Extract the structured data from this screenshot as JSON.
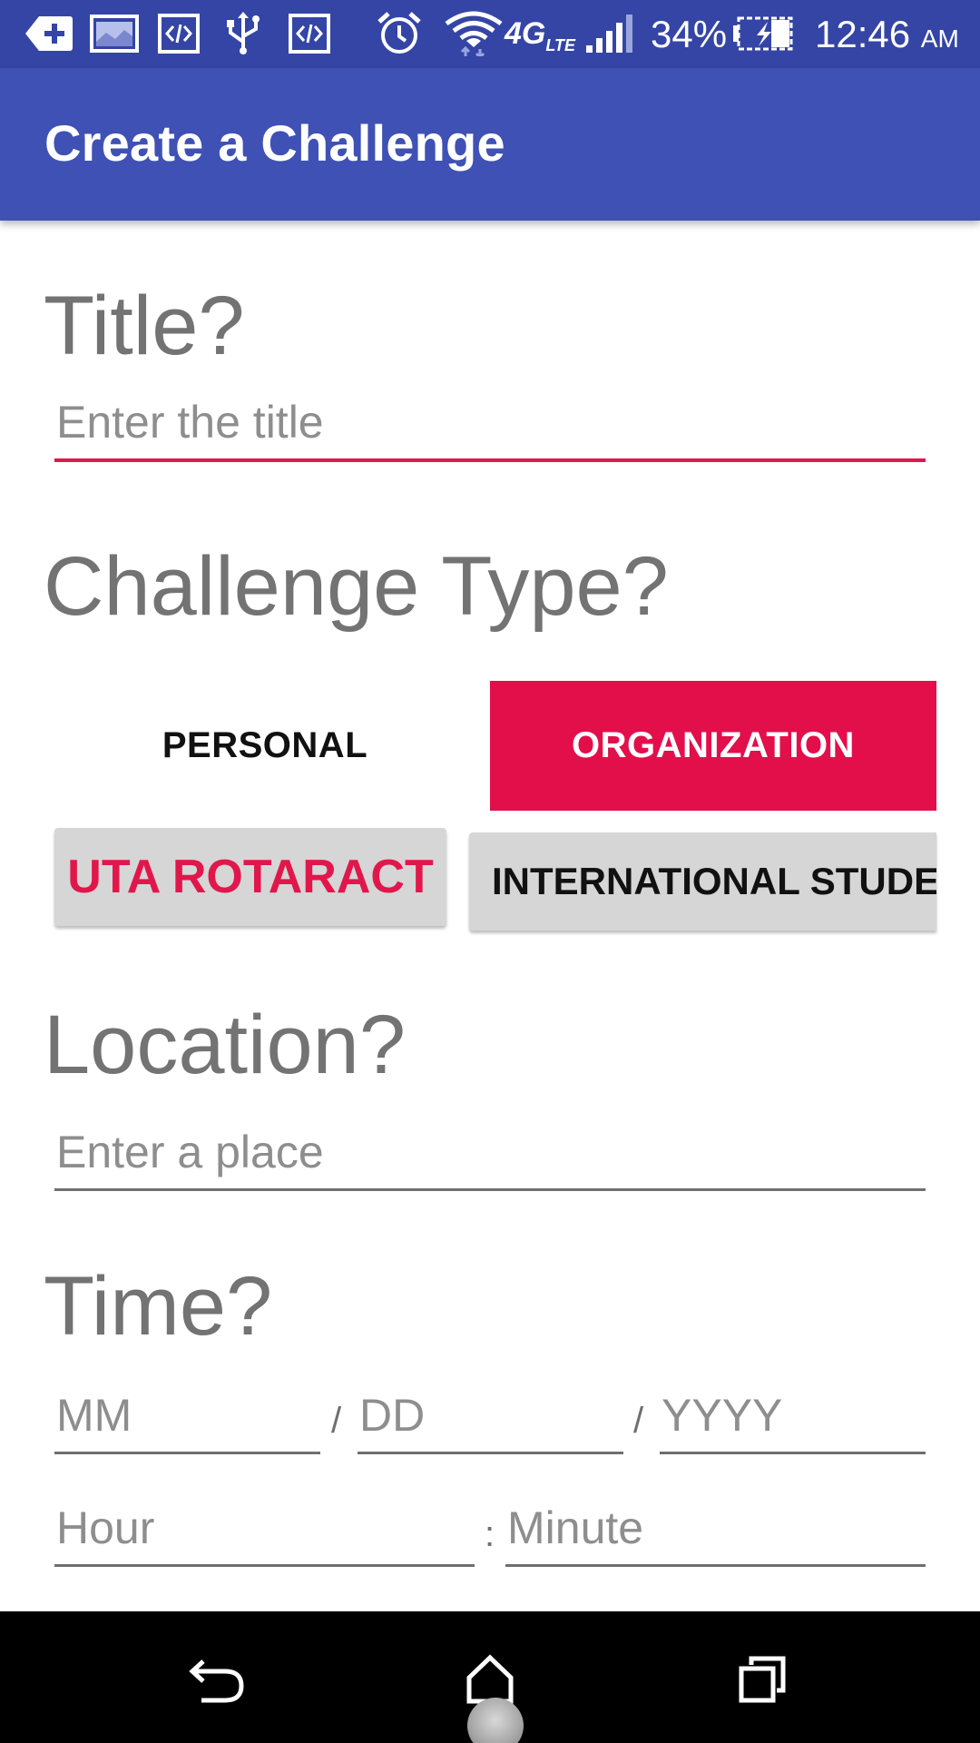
{
  "status_bar": {
    "battery_percent": "34%",
    "time": "12:46",
    "ampm": "AM",
    "network": "4G",
    "network_sub": "LTE",
    "icons": [
      "add-box-icon",
      "image-icon",
      "code-icon",
      "usb-icon",
      "code-icon",
      "alarm-icon",
      "wifi-icon",
      "signal-icon",
      "battery-charging-icon"
    ]
  },
  "app_bar": {
    "title": "Create a Challenge"
  },
  "form": {
    "title_label": "Title?",
    "title_placeholder": "Enter the title",
    "title_value": "",
    "type_label": "Challenge Type?",
    "type_options": [
      "PERSONAL",
      "ORGANIZATION"
    ],
    "selected_type": "ORGANIZATION",
    "organizations": [
      "UTA ROTARACT",
      "INTERNATIONAL STUDENT"
    ],
    "selected_organization": "UTA ROTARACT",
    "location_label": "Location?",
    "location_placeholder": "Enter a place",
    "time_label": "Time?",
    "month_placeholder": "MM",
    "day_placeholder": "DD",
    "year_placeholder": "YYYY",
    "date_separator": "/",
    "hour_placeholder": "Hour",
    "minute_placeholder": "Minute",
    "time_separator": ":"
  },
  "nav_bar": {
    "icons": [
      "back-icon",
      "home-icon",
      "recents-icon"
    ]
  },
  "colors": {
    "status_bar": "#3445a6",
    "app_bar": "#3f51b5",
    "accent": "#e20f4b",
    "label_gray": "#737373",
    "chip_gray": "#d6d6d6"
  }
}
